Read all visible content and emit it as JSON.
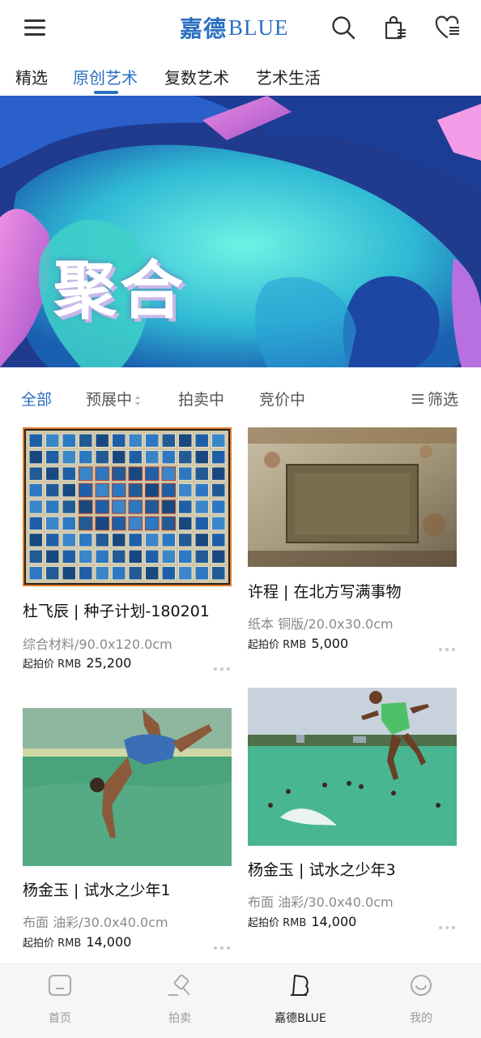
{
  "header": {
    "logo_cn": "嘉德",
    "logo_latin": "BLUE"
  },
  "tabs": [
    {
      "label": "精选",
      "active": false
    },
    {
      "label": "原创艺术",
      "active": true
    },
    {
      "label": "复数艺术",
      "active": false
    },
    {
      "label": "艺术生活",
      "active": false
    }
  ],
  "banner": {
    "title": "聚合",
    "dots_count": 7,
    "active_dot": 0
  },
  "filters": {
    "items": [
      {
        "label": "全部",
        "active": true
      },
      {
        "label": "预展中",
        "active": false
      },
      {
        "label": "拍卖中",
        "active": false
      },
      {
        "label": "竞价中",
        "active": false
      }
    ],
    "filter_button": "筛选"
  },
  "cards": [
    {
      "title": "杜飞辰 | 种子计划-180201",
      "material": "综合材料/90.0x120.0cm",
      "price_label": "起拍价 RMB",
      "price": "25,200"
    },
    {
      "title": "许程 | 在北方写满事物",
      "material": "纸本 铜版/20.0x30.0cm",
      "price_label": "起拍价 RMB",
      "price": "5,000"
    },
    {
      "title": "杨金玉 | 试水之少年1",
      "material": "布面 油彩/30.0x40.0cm",
      "price_label": "起拍价 RMB",
      "price": "14,000"
    },
    {
      "title": "杨金玉 | 试水之少年3",
      "material": "布面 油彩/30.0x40.0cm",
      "price_label": "起拍价 RMB",
      "price": "14,000"
    }
  ],
  "bottom_nav": [
    {
      "label": "首页",
      "icon": "home-icon",
      "active": false
    },
    {
      "label": "拍卖",
      "icon": "gavel-icon",
      "active": false
    },
    {
      "label": "嘉德BLUE",
      "icon": "blue-b-icon",
      "active": true
    },
    {
      "label": "我的",
      "icon": "profile-icon",
      "active": false
    }
  ],
  "colors": {
    "accent": "#2a6fc1",
    "text": "#222222",
    "muted": "#8a8a8a"
  }
}
